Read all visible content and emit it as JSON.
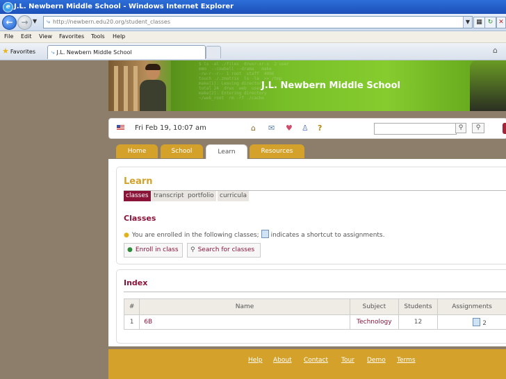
{
  "window": {
    "title": "J.L. Newbern Middle School - Windows Internet Explorer"
  },
  "browser": {
    "address": "http://newbern.edu20.org/student_classes",
    "menu": [
      "File",
      "Edit",
      "View",
      "Favorites",
      "Tools",
      "Help"
    ],
    "favorites_label": "Favorites",
    "tab_title": "J.L. Newbern Middle School"
  },
  "header": {
    "school_name": "J.L. Newbern Middle School",
    "date": "Fri Feb 19, 10:07 am",
    "search": {
      "value": ""
    }
  },
  "nav": {
    "tabs": [
      {
        "label": "Home"
      },
      {
        "label": "School"
      },
      {
        "label": "Learn",
        "active": true
      },
      {
        "label": "Resources"
      }
    ]
  },
  "learn": {
    "heading": "Learn",
    "subtabs": [
      {
        "label": "classes",
        "active": true
      },
      {
        "label": "transcript"
      },
      {
        "label": "portfolio"
      },
      {
        "label": "curricula"
      }
    ],
    "classes_heading": "Classes",
    "hint_before": "You are enrolled in the following classes;",
    "hint_after": "indicates a shortcut to assignments.",
    "buttons": {
      "enroll": "Enroll in class",
      "search": "Search for classes"
    }
  },
  "index": {
    "heading": "Index",
    "columns": [
      "#",
      "Name",
      "Subject",
      "Students",
      "Assignments"
    ],
    "rows": [
      {
        "num": "1",
        "name": "6B",
        "subject": "Technology",
        "students": "12",
        "assignments": "2"
      }
    ]
  },
  "footer": {
    "links": [
      "Help",
      "About",
      "Contact",
      "Tour",
      "Demo",
      "Terms"
    ]
  }
}
